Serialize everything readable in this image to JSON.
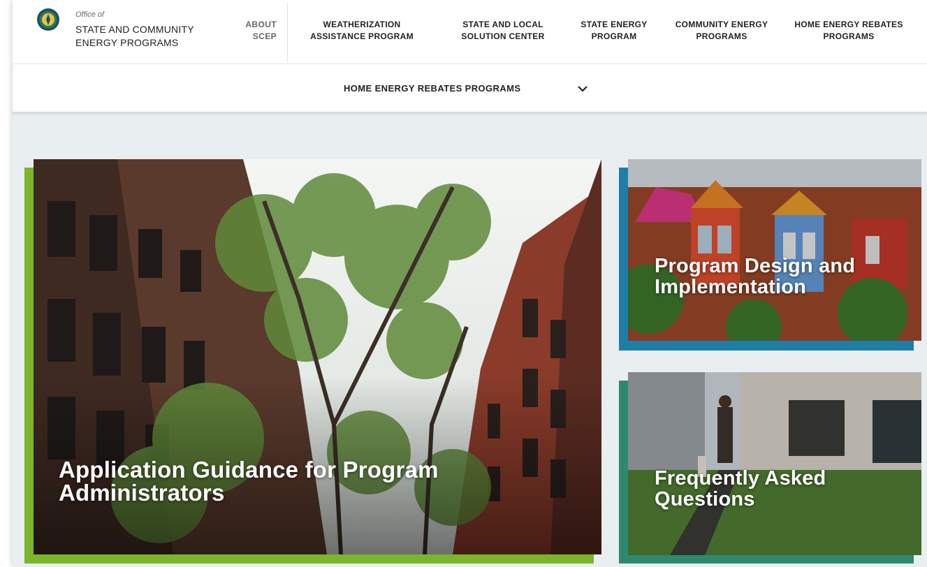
{
  "header": {
    "office_of": "Office of",
    "org_name": "STATE AND COMMUNITY ENERGY PROGRAMS",
    "about": "ABOUT SCEP",
    "nav": [
      {
        "label": "WEATHERIZATION ASSISTANCE PROGRAM"
      },
      {
        "label": "STATE AND LOCAL SOLUTION CENTER"
      },
      {
        "label": "STATE ENERGY PROGRAM"
      },
      {
        "label": "COMMUNITY ENERGY PROGRAMS"
      },
      {
        "label": "HOME ENERGY REBATES PROGRAMS"
      }
    ]
  },
  "subnav": {
    "label": "HOME ENERGY REBATES PROGRAMS",
    "icon": "chevron-down-icon"
  },
  "cards": {
    "main": {
      "title": "Application Guidance for Program Administrators",
      "accent": "#7ab52c"
    },
    "design": {
      "title": "Program Design and Implementation",
      "accent": "#1f7ea6"
    },
    "faq": {
      "title": "Frequently Asked Questions",
      "accent": "#2d8a6e"
    }
  },
  "colors": {
    "background": "#e9eef0",
    "header_bg": "#ffffff",
    "text": "#222222"
  }
}
